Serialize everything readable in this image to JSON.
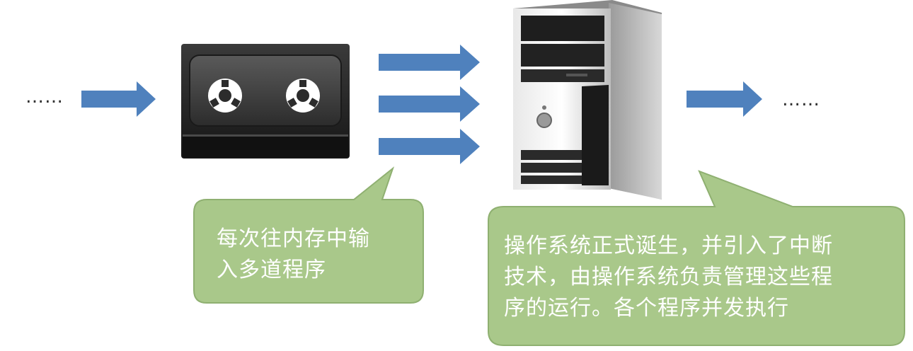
{
  "diagram": {
    "left_ellipsis": "……",
    "right_ellipsis": "……",
    "tape_icon": "cassette-tape-icon",
    "computer_icon": "desktop-tower-computer-icon",
    "arrow_color": "#4f81bd",
    "bubble_color": "#a9c88a",
    "bubble_border": "#8fb071",
    "bubble_left": {
      "lines": [
        "每次往内存中输",
        "入多道程序"
      ]
    },
    "bubble_right": {
      "lines": [
        "操作系统正式诞生，并引入了中断",
        "技术，由操作系统负责管理这些程",
        "序的运行。各个程序并发执行"
      ]
    }
  }
}
